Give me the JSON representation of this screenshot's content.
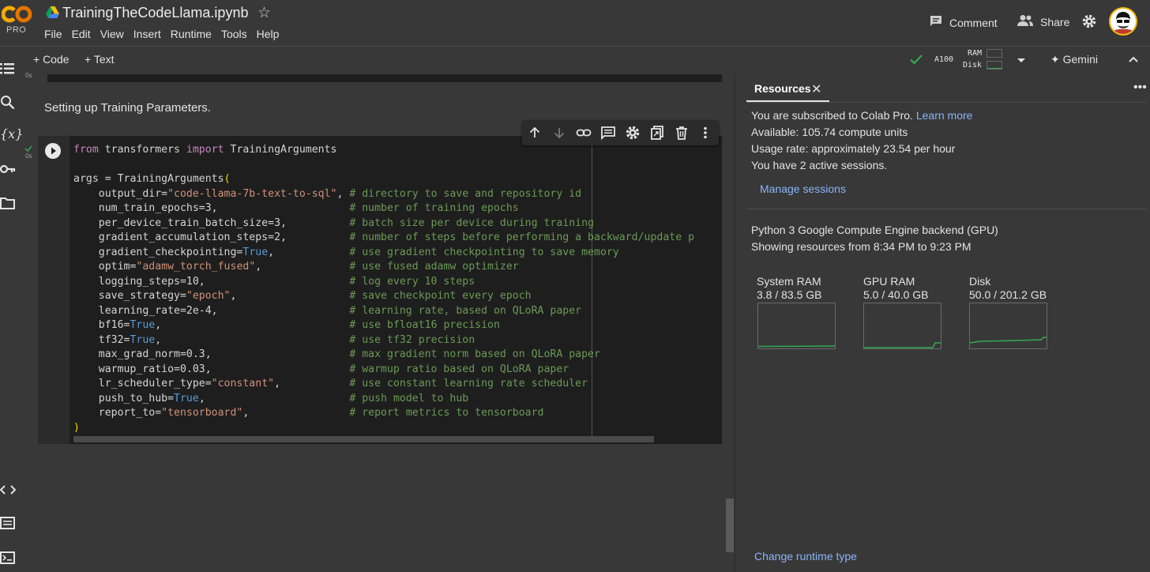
{
  "header": {
    "brand": "CO",
    "plan_badge": "PRO",
    "notebook_title": "TrainingTheCodeLlama.ipynb",
    "menu": [
      "File",
      "Edit",
      "View",
      "Insert",
      "Runtime",
      "Tools",
      "Help"
    ],
    "comment_label": "Comment",
    "share_label": "Share"
  },
  "toolbar": {
    "add_code_label": "+ Code",
    "add_text_label": "+ Text",
    "accelerator": "A100",
    "ram_label": "RAM",
    "disk_label": "Disk",
    "gemini_label": "Gemini"
  },
  "notebook": {
    "previous_cell_time": "0s",
    "markdown_text": "Setting up Training Parameters.",
    "cell_time": "0s",
    "code_lines": [
      [
        {
          "t": "from",
          "c": "kw"
        },
        {
          "t": " transformers "
        },
        {
          "t": "import",
          "c": "kw"
        },
        {
          "t": " TrainingArguments"
        }
      ],
      [
        {
          "t": ""
        }
      ],
      [
        {
          "t": "args = TrainingArguments"
        },
        {
          "t": "(",
          "c": "br"
        }
      ],
      [
        {
          "t": "    output_dir="
        },
        {
          "t": "\"code-llama-7b-text-to-sql\"",
          "c": "str"
        },
        {
          "t": ", "
        },
        {
          "t": "# directory to save and repository id",
          "c": "cm"
        }
      ],
      [
        {
          "t": "    num_train_epochs=3,                     "
        },
        {
          "t": "# number of training epochs",
          "c": "cm"
        }
      ],
      [
        {
          "t": "    per_device_train_batch_size=3,          "
        },
        {
          "t": "# batch size per device during training",
          "c": "cm"
        }
      ],
      [
        {
          "t": "    gradient_accumulation_steps=2,          "
        },
        {
          "t": "# number of steps before performing a backward/update p",
          "c": "cm"
        }
      ],
      [
        {
          "t": "    gradient_checkpointing="
        },
        {
          "t": "True",
          "c": "bool"
        },
        {
          "t": ",            "
        },
        {
          "t": "# use gradient checkpointing to save memory",
          "c": "cm"
        }
      ],
      [
        {
          "t": "    optim="
        },
        {
          "t": "\"adamw_torch_fused\"",
          "c": "str"
        },
        {
          "t": ",              "
        },
        {
          "t": "# use fused adamw optimizer",
          "c": "cm"
        }
      ],
      [
        {
          "t": "    logging_steps=10,                       "
        },
        {
          "t": "# log every 10 steps",
          "c": "cm"
        }
      ],
      [
        {
          "t": "    save_strategy="
        },
        {
          "t": "\"epoch\"",
          "c": "str"
        },
        {
          "t": ",                  "
        },
        {
          "t": "# save checkpoint every epoch",
          "c": "cm"
        }
      ],
      [
        {
          "t": "    learning_rate=2e-4,                     "
        },
        {
          "t": "# learning rate, based on QLoRA paper",
          "c": "cm"
        }
      ],
      [
        {
          "t": "    bf16="
        },
        {
          "t": "True",
          "c": "bool"
        },
        {
          "t": ",                              "
        },
        {
          "t": "# use bfloat16 precision",
          "c": "cm"
        }
      ],
      [
        {
          "t": "    tf32="
        },
        {
          "t": "True",
          "c": "bool"
        },
        {
          "t": ",                              "
        },
        {
          "t": "# use tf32 precision",
          "c": "cm"
        }
      ],
      [
        {
          "t": "    max_grad_norm=0.3,                      "
        },
        {
          "t": "# max gradient norm based on QLoRA paper",
          "c": "cm"
        }
      ],
      [
        {
          "t": "    warmup_ratio=0.03,                      "
        },
        {
          "t": "# warmup ratio based on QLoRA paper",
          "c": "cm"
        }
      ],
      [
        {
          "t": "    lr_scheduler_type="
        },
        {
          "t": "\"constant\"",
          "c": "str"
        },
        {
          "t": ",           "
        },
        {
          "t": "# use constant learning rate scheduler",
          "c": "cm"
        }
      ],
      [
        {
          "t": "    push_to_hub="
        },
        {
          "t": "True",
          "c": "bool"
        },
        {
          "t": ",                       "
        },
        {
          "t": "# push model to hub",
          "c": "cm"
        }
      ],
      [
        {
          "t": "    report_to="
        },
        {
          "t": "\"tensorboard\"",
          "c": "str"
        },
        {
          "t": ",                "
        },
        {
          "t": "# report metrics to tensorboard",
          "c": "cm"
        }
      ],
      [
        {
          "t": ")",
          "c": "br"
        }
      ]
    ]
  },
  "resources": {
    "tab_label": "Resources",
    "subscription_text": "You are subscribed to Colab Pro.",
    "learn_more": "Learn more",
    "available": "Available: 105.74 compute units",
    "usage_rate": "Usage rate: approximately 23.54 per hour",
    "sessions": "You have 2 active sessions.",
    "manage_sessions": "Manage sessions",
    "backend": "Python 3 Google Compute Engine backend (GPU)",
    "showing_range": "Showing resources from 8:34 PM to 9:23 PM",
    "gauges": [
      {
        "title": "System RAM",
        "value": "3.8 / 83.5 GB",
        "fraction": 0.046
      },
      {
        "title": "GPU RAM",
        "value": "5.0 / 40.0 GB",
        "fraction": 0.125
      },
      {
        "title": "Disk",
        "value": "50.0 / 201.2 GB",
        "fraction": 0.249
      }
    ],
    "change_runtime": "Change runtime type"
  },
  "colors": {
    "background": "#383838",
    "code_bg": "#1e1e1e",
    "link": "#8ab4f8",
    "success": "#34a853",
    "logo_orange": "#f9ab00"
  },
  "icons": [
    "toc-icon",
    "search-icon",
    "variables-icon",
    "key-icon",
    "folder-icon",
    "code-snippets-icon",
    "command-palette-icon",
    "terminal-icon",
    "comment-icon",
    "people-icon",
    "gear-icon",
    "check-icon",
    "arrow-up-icon",
    "arrow-down-icon",
    "link-icon",
    "comment-cell-icon",
    "cell-settings-icon",
    "mirror-cell-icon",
    "trash-icon",
    "more-vert-icon",
    "play-icon",
    "close-icon",
    "sparkle-icon",
    "chevron-up-icon",
    "dropdown-icon"
  ]
}
